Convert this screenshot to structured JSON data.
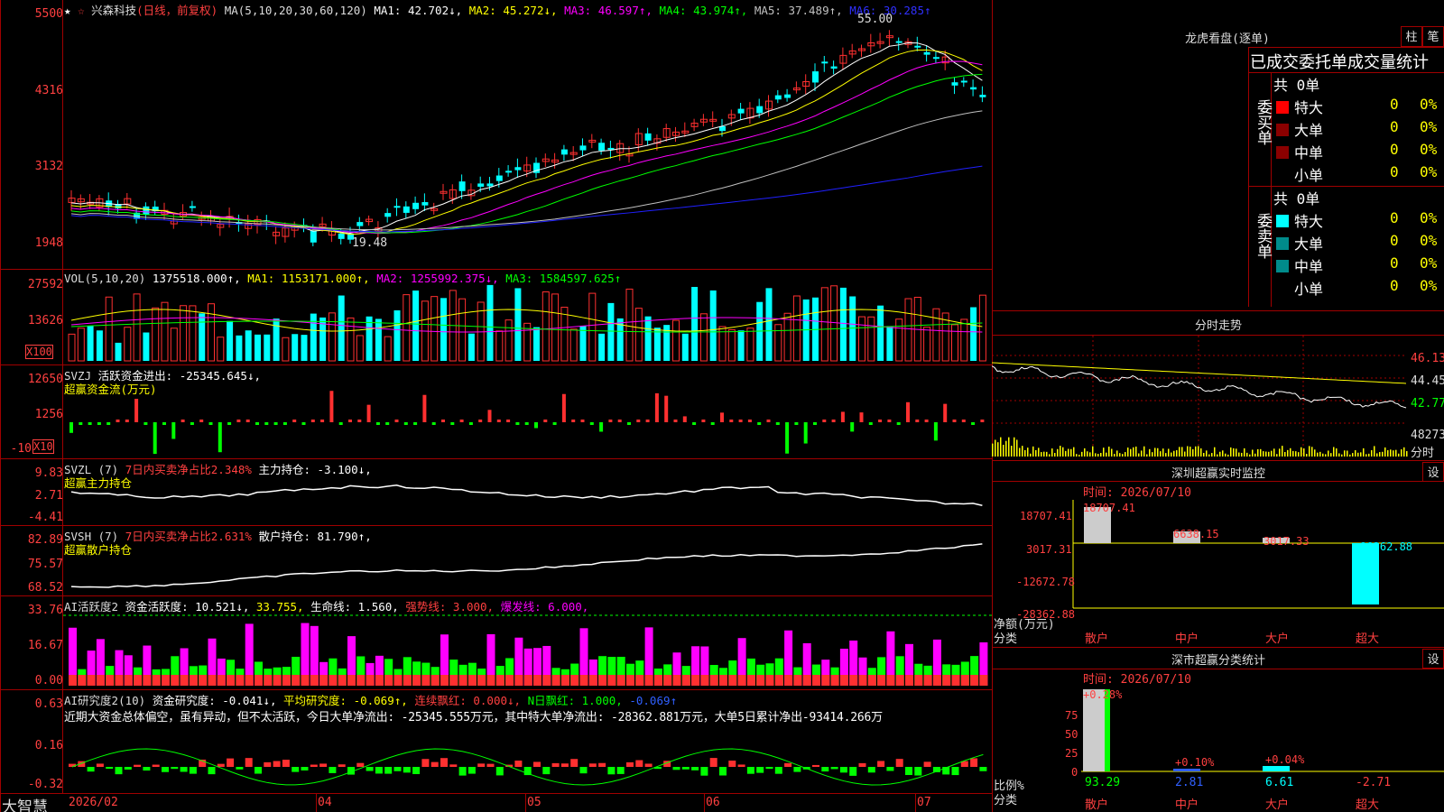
{
  "colors": {
    "up": "#ff3030",
    "down": "#00ffff",
    "grid": "#a00000",
    "ma1": "#ffffff",
    "ma2": "#ffff00",
    "ma3": "#ff00ff",
    "ma4": "#00ff00",
    "ma5": "#c0c0c0",
    "ma6": "#2020ff",
    "green": "#00ff00",
    "magenta": "#ff00ff",
    "yellow": "#ffff00"
  },
  "icons": {
    "star": "star-icon"
  },
  "main": {
    "star": "★",
    "star2": "☆",
    "name": "兴森科技",
    "mode": "(日线，前复权)",
    "ma_params": "MA(5,10,20,30,60,120)",
    "ma1": "MA1: 42.702↓,",
    "ma2": "MA2: 45.272↓,",
    "ma3": "MA3: 46.597↑,",
    "ma4": "MA4: 43.974↑,",
    "ma5": "MA5: 37.489↑,",
    "ma6": "MA6: 30.285↑",
    "high_label": "55.00",
    "low_label": "19.48",
    "y_ticks": [
      "5500",
      "4316",
      "3132",
      "1948"
    ]
  },
  "vol": {
    "params": "VOL(5,10,20)",
    "value": "1375518.000↑,",
    "ma1": "MA1: 1153171.000↑,",
    "ma2": "MA2: 1255992.375↓,",
    "ma3": "MA3: 1584597.625↑",
    "y_ticks": [
      "27592",
      "13626"
    ],
    "unit": "X100"
  },
  "svzj": {
    "name": "SVZJ",
    "label": "活跃资金进出: -25345.645↓,",
    "sub": "超赢资金流(万元)",
    "y_ticks": [
      "12650",
      "1256",
      "-10"
    ],
    "unit": "X10"
  },
  "svzl": {
    "name": "SVZL (7)",
    "ratio": "7日内买卖净占比2.348%",
    "hold": "主力持仓: -3.100↓,",
    "sub": "超赢主力持仓",
    "y_ticks": [
      "9.83",
      "2.71",
      "-4.41"
    ]
  },
  "svsh": {
    "name": "SVSH (7)",
    "ratio": "7日内买卖净占比2.631%",
    "hold": "散户持仓: 81.790↑,",
    "sub": "超赢散户持仓",
    "y_ticks": [
      "82.89",
      "75.57",
      "68.52"
    ]
  },
  "ai1": {
    "name": "AI活跃度2",
    "a": "资金活跃度: 10.521↓,",
    "b": "33.755,",
    "c": "生命线: 1.560,",
    "d": "强势线: 3.000,",
    "e": "爆发线: 6.000,",
    "y_ticks": [
      "33.76",
      "16.67",
      "0.00"
    ]
  },
  "ai2": {
    "name": "AI研究度2(10)",
    "a": "资金研究度: -0.041↓,",
    "b": "平均研究度: -0.069↑,",
    "c": "连续飘红: 0.000↓,",
    "d": "N日飘红: 1.000,",
    "e": "-0.069↑",
    "summary": "近期大资金总体偏空，虽有异动，但不太活跃，今日大单净流出: -25345.555万元，其中特大单净流出: -28362.881万元，大单5日累计净出-93414.266万",
    "y_ticks": [
      "0.63",
      "0.16",
      "-0.32"
    ]
  },
  "xaxis": {
    "logo": "大智慧",
    "labels": [
      "2026/02",
      "04",
      "05",
      "06",
      "07"
    ]
  },
  "right": {
    "lhb_title": "龙虎看盘(逐单)",
    "btn_bar": "柱",
    "btn_pen": "笔",
    "header": "已成交委托单成交量统计",
    "buy_side": "委买单",
    "sell_side": "委卖单",
    "total_buy": "共 0单",
    "total_sell": "共 0单",
    "rows_buy": [
      {
        "name": "特大",
        "v": "0",
        "p": "0%"
      },
      {
        "name": "大单",
        "v": "0",
        "p": "0%"
      },
      {
        "name": "中单",
        "v": "0",
        "p": "0%"
      },
      {
        "name": "小单",
        "v": "0",
        "p": "0%"
      }
    ],
    "rows_sell": [
      {
        "name": "特大",
        "v": "0",
        "p": "0%"
      },
      {
        "name": "大单",
        "v": "0",
        "p": "0%"
      },
      {
        "name": "中单",
        "v": "0",
        "p": "0%"
      },
      {
        "name": "小单",
        "v": "0",
        "p": "0%"
      }
    ],
    "fs_title": "分时走势",
    "fs_ticks": [
      "46.13",
      "44.45",
      "42.77",
      "48273"
    ],
    "fs_unit": "分时",
    "mon_title": "深圳超赢实时监控",
    "mon_time": "时间: 2026/07/10",
    "mon_ticks": [
      "18707.41",
      "3017.31",
      "-12672.78",
      "-28362.88"
    ],
    "mon_vals": [
      "18707.41",
      "6638.15",
      "3017.33",
      "-28362.88"
    ],
    "mon_unit1": "净额(万元)",
    "mon_unit2": "分类",
    "cats": [
      "散户",
      "中户",
      "大户",
      "超大"
    ],
    "set": "设",
    "cls_title": "深市超赢分类统计",
    "cls_time": "时间: 2026/07/10",
    "cls_pcts": [
      "+0.28%",
      "+0.10%",
      "+0.04%"
    ],
    "cls_ticks": [
      "75",
      "50",
      "25",
      "0"
    ],
    "cls_unit1": "比例%",
    "cls_unit2": "分类",
    "cls_vals": [
      "93.29",
      "2.81",
      "6.61",
      "-2.71"
    ]
  }
}
